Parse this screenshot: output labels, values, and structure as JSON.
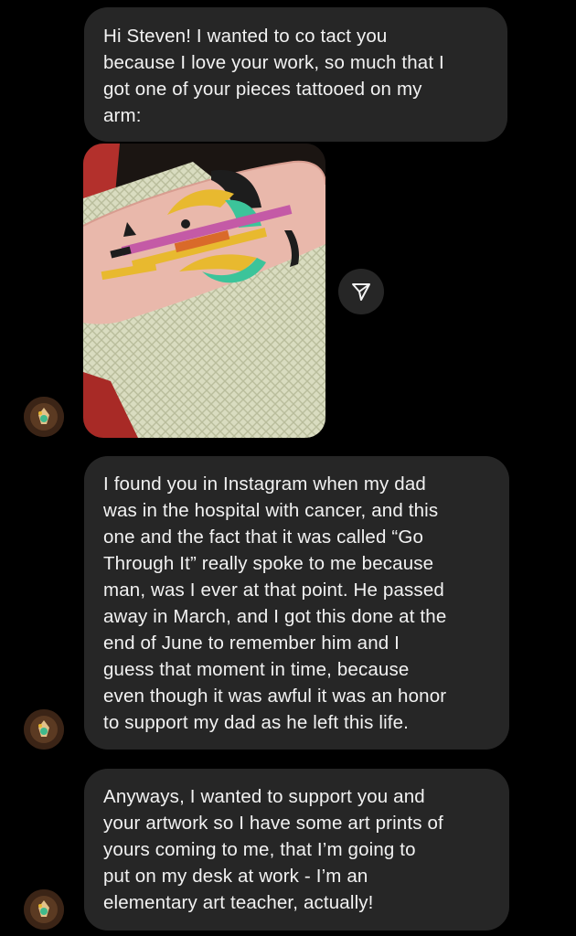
{
  "messages": [
    {
      "text": "Hi Steven! I wanted to co tact you\nbecause I love your work, so much that I\ngot one of your pieces tattooed on my\narm:"
    },
    {
      "text": "I found you in Instagram when my dad\nwas in the hospital with cancer, and this\none and the fact that it was called “Go\nThrough It” really spoke to me because\nman, was I ever at that point. He passed\naway in March, and I got this done at the\nend of June to remember him and I\nguess that moment in time, because\neven though it was awful it was an honor\nto support my dad as he left this life."
    },
    {
      "text": "Anyways, I wanted to support you and\nyour artwork so I have some art prints of\nyours coming to me, that I’m going to\nput on my desk at work - I’m an\nelementary art teacher, actually!"
    }
  ],
  "icons": {
    "share": "paper-plane-icon",
    "avatar": "sender-avatar"
  },
  "colors": {
    "background": "#000000",
    "bubble": "#262626",
    "text": "#f2f2f2"
  }
}
